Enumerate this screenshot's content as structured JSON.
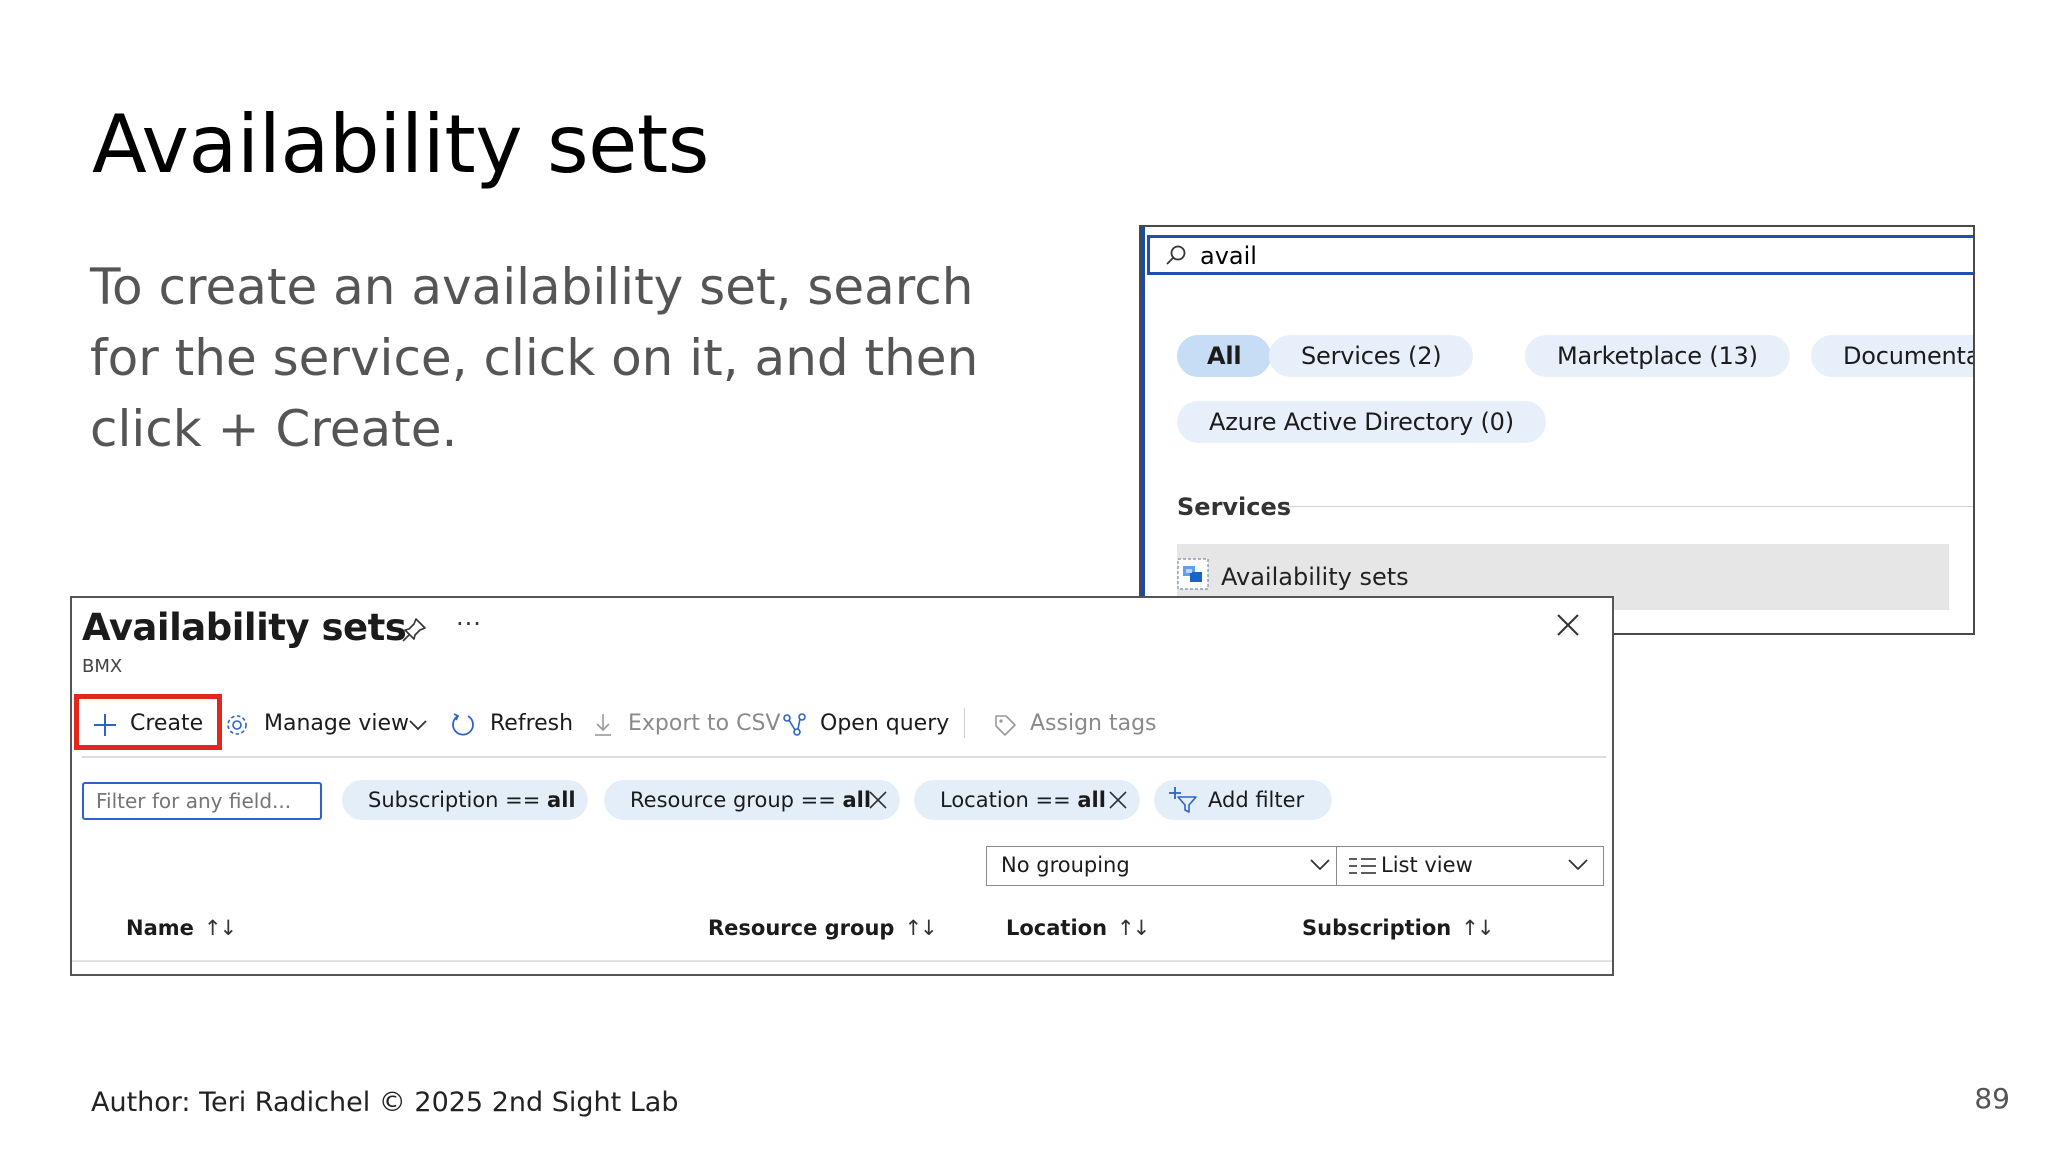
{
  "slide": {
    "title": "Availability sets",
    "body": "To create an availability set, search for the service, click on it, and then click + Create.",
    "author": "Author: Teri Radichel © 2025 2nd Sight Lab",
    "page_number": "89"
  },
  "search_panel": {
    "query": "avail",
    "pills": [
      {
        "label": "All",
        "active": true
      },
      {
        "label": "Services  (2)"
      },
      {
        "label": "Marketplace  (13)"
      },
      {
        "label": "Documentati"
      },
      {
        "label": "Azure Active Directory  (0)"
      }
    ],
    "services_heading": "Services",
    "result_label": "Availability sets"
  },
  "blade": {
    "title": "Availability sets",
    "subtitle": "BMX",
    "more": "···",
    "toolbar": {
      "create": "Create",
      "manage_view": "Manage view",
      "refresh": "Refresh",
      "export_csv": "Export to CSV",
      "open_query": "Open query",
      "assign_tags": "Assign tags"
    },
    "filter_placeholder": "Filter for any field...",
    "filters": {
      "subscription_label": "Subscription == ",
      "subscription_value": "all",
      "resource_group_label": "Resource group == ",
      "resource_group_value": "all",
      "location_label": "Location == ",
      "location_value": "all",
      "add_filter": "Add filter"
    },
    "grouping": "No grouping",
    "view": "List view",
    "columns": {
      "name": "Name",
      "resource_group": "Resource group",
      "location": "Location",
      "subscription": "Subscription"
    }
  },
  "colors": {
    "highlight": "#e1281c",
    "accent": "#1f4fb5",
    "pill": "#e4eef9"
  }
}
